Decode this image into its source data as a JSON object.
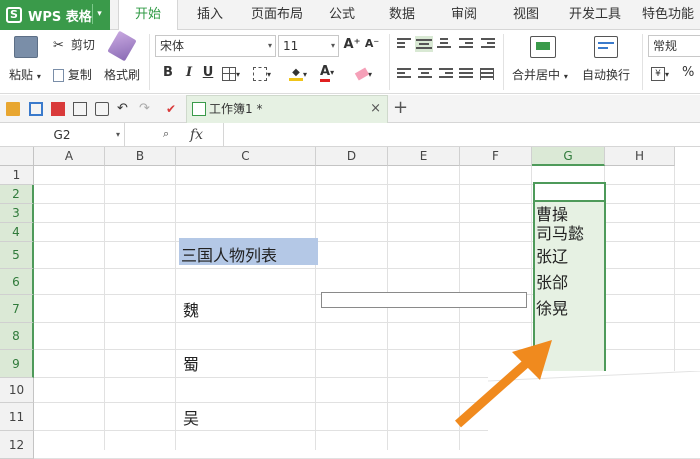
{
  "app": {
    "name": "WPS 表格",
    "logo_letter": "S",
    "caret": "▾"
  },
  "menu_tabs": [
    {
      "label": "开始",
      "active": true
    },
    {
      "label": "插入"
    },
    {
      "label": "页面布局"
    },
    {
      "label": "公式"
    },
    {
      "label": "数据"
    },
    {
      "label": "审阅"
    },
    {
      "label": "视图"
    },
    {
      "label": "开发工具"
    },
    {
      "label": "特色功能"
    }
  ],
  "ribbon": {
    "paste_label": "粘贴",
    "cut_label": "剪切",
    "copy_label": "复制",
    "format_painter_label": "格式刷",
    "font_name": "宋体",
    "font_size": "11",
    "grow_font": "A⁺",
    "shrink_font": "A⁻",
    "bold": "B",
    "italic": "I",
    "underline": "U",
    "merge_center_label": "合并居中",
    "wrap_text_label": "自动换行",
    "number_format": "常规",
    "percent": "%",
    "dropdown_arrow": "▾"
  },
  "doc_tab": {
    "title": "工作簿1 *",
    "close": "×",
    "new_tab": "+"
  },
  "formula_bar": {
    "cell_ref": "G2",
    "fx": "fx",
    "zoom_icon": "🔍",
    "value": ""
  },
  "grid": {
    "columns": [
      "A",
      "B",
      "C",
      "D",
      "E",
      "F",
      "G",
      "H"
    ],
    "selected_column": "G",
    "rows": [
      "1",
      "2",
      "3",
      "4",
      "5",
      "6",
      "7",
      "8",
      "9",
      "10",
      "11",
      "12"
    ],
    "selected_rows": [
      "2",
      "3",
      "4",
      "5",
      "6",
      "7",
      "8",
      "9"
    ]
  },
  "cells": {
    "c5_title": "三国人物列表",
    "c7": "魏",
    "c9": "蜀",
    "c11": "吴",
    "g_list": [
      "曹操",
      "司马懿",
      "张辽",
      "张郃",
      "徐晃"
    ]
  },
  "colors": {
    "accent_green": "#3a9a4a",
    "selection_fill": "#e6f1e3",
    "title_fill": "#b4c8e6",
    "arrow": "#f08a1e"
  }
}
